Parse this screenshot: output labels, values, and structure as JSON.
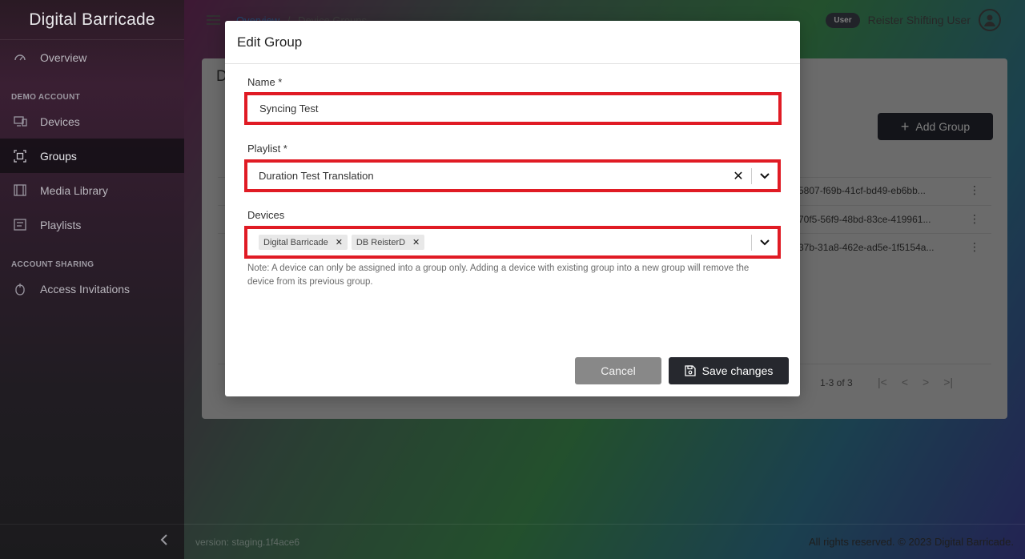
{
  "sidebar": {
    "app_title": "Digital Barricade",
    "overview": "Overview",
    "section_demo": "DEMO ACCOUNT",
    "devices": "Devices",
    "groups": "Groups",
    "media_library": "Media Library",
    "playlists": "Playlists",
    "section_sharing": "ACCOUNT SHARING",
    "access_invitations": "Access Invitations"
  },
  "topbar": {
    "breadcrumb_root": "Overview",
    "breadcrumb_sep": "/",
    "breadcrumb_current": "Device Groups",
    "user_badge": "User",
    "user_name": "Reister Shifting User"
  },
  "background_card": {
    "title_initial": "D",
    "add_group_label": "Add Group",
    "rows": [
      {
        "id": "5807-f69b-41cf-bd49-eb6bb..."
      },
      {
        "id": "70f5-56f9-48bd-83ce-419961..."
      },
      {
        "id": "37b-31a8-462e-ad5e-1f5154a..."
      }
    ],
    "pager_text": "1-3 of 3"
  },
  "modal": {
    "title": "Edit Group",
    "name_label": "Name *",
    "name_value": "Syncing Test",
    "playlist_label": "Playlist *",
    "playlist_value": "Duration Test Translation",
    "devices_label": "Devices",
    "device_chips": [
      "Digital Barricade",
      "DB ReisterD"
    ],
    "note": "Note: A device can only be assigned into a group only. Adding a device with existing group into a new group will remove the device from its previous group.",
    "cancel_label": "Cancel",
    "save_label": "Save changes"
  },
  "footer": {
    "version": "version: staging.1f4ace6",
    "rights": "All rights reserved. © 2023 Digital Barricade."
  },
  "colors": {
    "highlight_border": "#e01b24",
    "save_button": "#26282e",
    "cancel_button": "#888888"
  }
}
